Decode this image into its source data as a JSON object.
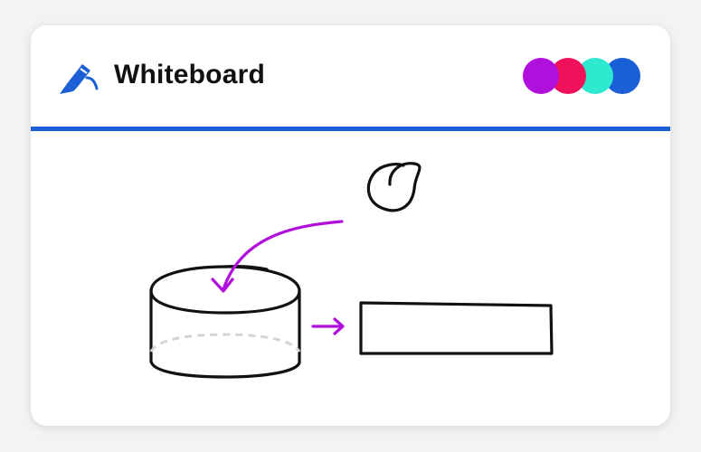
{
  "app": {
    "title": "Whiteboard",
    "icon": "marker-pen-icon"
  },
  "colors": {
    "accent": "#1a5fd6",
    "connector": "#b10fdb",
    "stroke": "#111111",
    "hidden_edge": "#d4d4d4"
  },
  "collaborators": [
    {
      "name": "collaborator-purple",
      "color": "#b10fdb"
    },
    {
      "name": "collaborator-pink",
      "color": "#f0115a"
    },
    {
      "name": "collaborator-teal",
      "color": "#2ee8cf"
    },
    {
      "name": "collaborator-blue",
      "color": "#1a5fd6"
    }
  ],
  "canvas": {
    "shapes": [
      "cylinder",
      "circle",
      "rectangle"
    ],
    "connectors": [
      "curved-arrow",
      "straight-arrow"
    ]
  }
}
